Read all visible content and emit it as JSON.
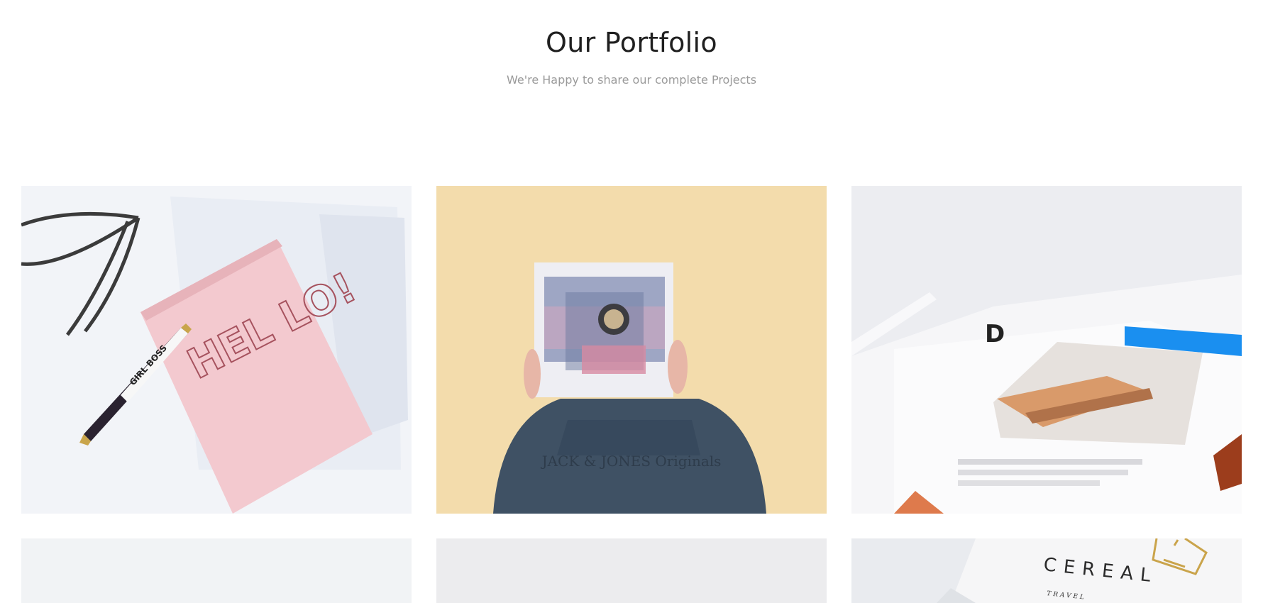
{
  "header": {
    "title": "Our Portfolio",
    "subtitle": "We're Happy to share our complete Projects"
  },
  "portfolio": {
    "items": [
      {
        "image_label": "HEL LO!",
        "pen_text": "GIRL BOSS"
      },
      {
        "image_label": "JACK & JONES Originals"
      },
      {
        "image_label": "D"
      },
      {
        "image_label": ""
      },
      {
        "image_label": ""
      },
      {
        "image_label": "CEREAL",
        "caption": "TRAVEL"
      }
    ]
  },
  "colors": {
    "title": "#1f1f1f",
    "subtitle": "#9a9a9a",
    "background": "#ffffff",
    "tile_yellow": "#f1d9a6",
    "tile_pink": "#f3c9cf",
    "tile_blue_tape": "#1a8ff0"
  }
}
